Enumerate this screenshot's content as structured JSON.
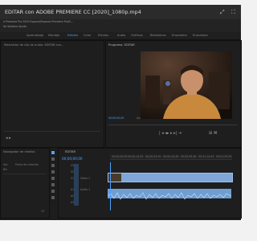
{
  "title": {
    "text": "EDITAR con ADOBE PREMIERE CC [2020]_1080p.mp4"
  },
  "menu": {
    "path_line": "e Premiere Pro 2020 Espanol/Espanol Premiere Pro/S...",
    "items_line": "ito  Ventana  Ayuda"
  },
  "workspace": {
    "tabs": [
      "Aprendizaje",
      "Montaje",
      "Edición",
      "Color",
      "Efectos",
      "Audio",
      "Gráficos",
      "Bibliotecas",
      "Ensamblar",
      "Ensamblar"
    ],
    "active_index": 2
  },
  "source_panel": {
    "tab_label": "Mezclador de clip de audio: EDITAR con..."
  },
  "program_panel": {
    "tab_label": "Programa: EDITAR",
    "timecode_left": "00;00;00;00",
    "fit_label": "Ajustar"
  },
  "project_panel": {
    "tab_label": "Navegador de medios",
    "item1": "Sec",
    "item2": "Bin",
    "col_label": "Fecha de creación",
    "row_count": "13"
  },
  "timeline": {
    "tab_label": "EDITAR",
    "timecode": "00;00;00;00",
    "ticks": [
      "00;00;00;00",
      "00;00;14;29",
      "00;00;29;29",
      "00;00;44;28",
      "00;00;59;28",
      "00;01;14;29",
      "00;01;29;29"
    ],
    "tracks": [
      "V3",
      "V2",
      "V1",
      "A1",
      "A2",
      "A3"
    ],
    "track_names": [
      "",
      "",
      "Vídeo 1",
      "Audio 1",
      "",
      ""
    ]
  },
  "icons": {
    "win_controls": [
      "restore-icon",
      "fullscreen-icon"
    ],
    "tools": [
      "selection-tool-icon",
      "track-select-icon",
      "ripple-edit-icon",
      "razor-icon",
      "slip-icon",
      "pen-icon",
      "hand-icon",
      "type-icon"
    ]
  },
  "colors": {
    "accent": "#4ea1ff",
    "clip_video": "#7fa6d6",
    "clip_audio": "#6f9ed2"
  }
}
